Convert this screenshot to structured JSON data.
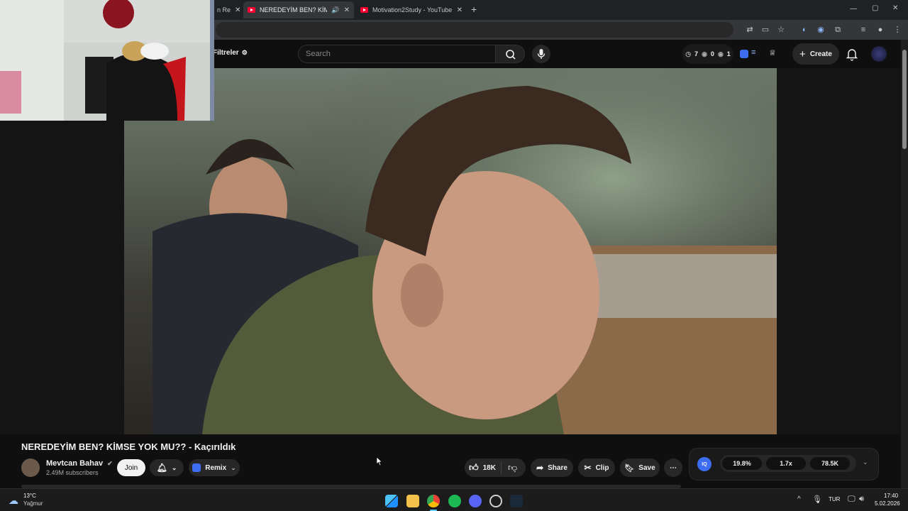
{
  "browser": {
    "tabs": [
      {
        "label": "n Re",
        "active": false
      },
      {
        "label": "NEREDEYİM BEN? KİMSE YO",
        "active": true,
        "audio": "🔊"
      },
      {
        "label": "Motivation2Study - YouTube",
        "active": false
      }
    ],
    "new_tab": "+",
    "window_controls": [
      "—",
      "▢",
      "✕"
    ]
  },
  "masthead": {
    "filters_label": "Filtreler",
    "search_placeholder": "Search",
    "stats": {
      "a": "7",
      "b": "0",
      "c": "1"
    },
    "create_label": "Create"
  },
  "video": {
    "title": "NEREDEYİM BEN? KİMSE YOK MU?? - Kaçırıldık",
    "channel": "Mevtcan Bahav",
    "subscribers": "2.49M subscribers",
    "join_label": "Join",
    "remix_label": "Remix",
    "likes": "18K",
    "share_label": "Share",
    "clip_label": "Clip",
    "save_label": "Save"
  },
  "extension_panel": {
    "badge": "IQ",
    "values": [
      "19.8%",
      "1.7x",
      "78.5K"
    ]
  },
  "taskbar": {
    "temp": "13°C",
    "weather": "Yağmur",
    "lang": "TUR",
    "time": "17:40",
    "date": "5.02.2026"
  },
  "colors": {
    "yt_red": "#ff0033",
    "accent_blue": "#3d6df2"
  }
}
